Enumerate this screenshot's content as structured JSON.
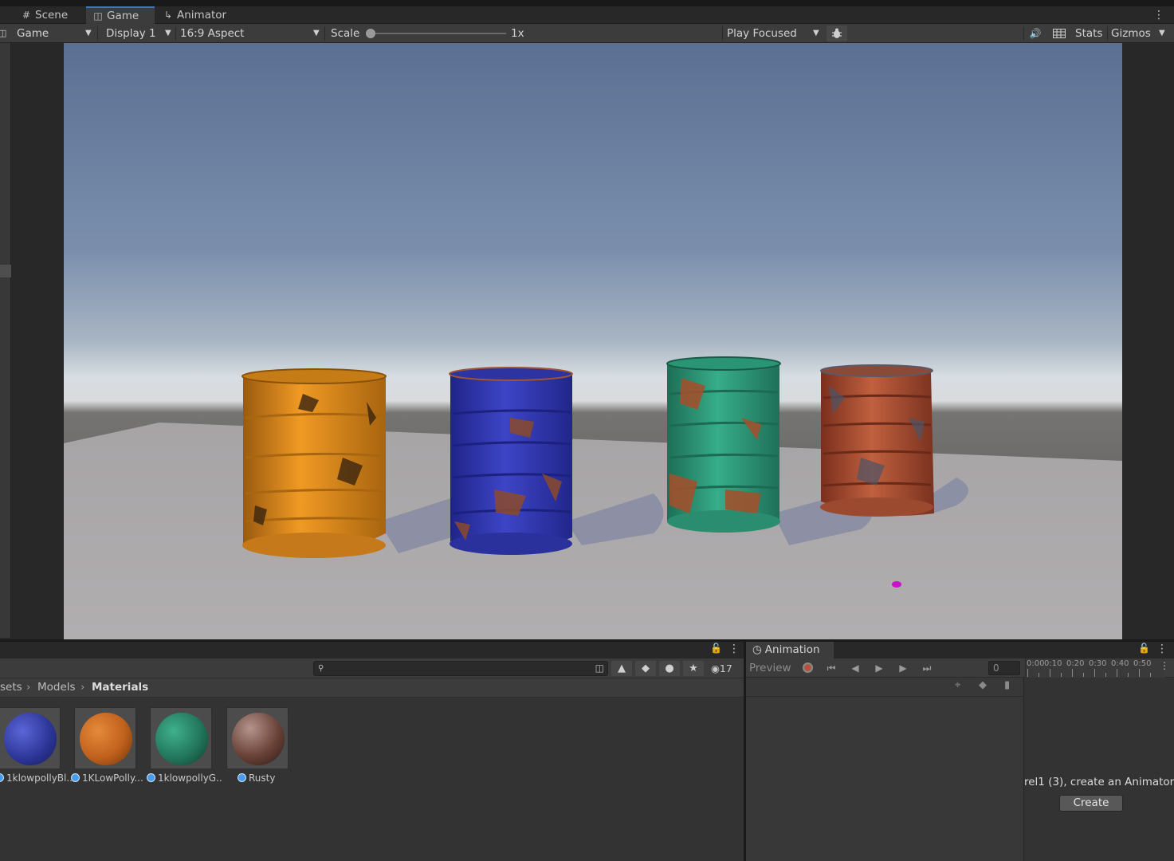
{
  "tabs": [
    {
      "label": "Scene",
      "icon": "grid-icon"
    },
    {
      "label": "Game",
      "icon": "gamepad-icon",
      "active": true
    },
    {
      "label": "Animator",
      "icon": "animator-icon"
    }
  ],
  "toolbar": {
    "view_select": "Game",
    "display_select": "Display 1",
    "aspect_select": "16:9 Aspect",
    "scale_label": "Scale",
    "scale_value": "1x",
    "play_mode_select": "Play Focused",
    "stats_label": "Stats",
    "gizmos_label": "Gizmos"
  },
  "project": {
    "hidden_count": "17",
    "breadcrumb": [
      "sets",
      "Models",
      "Materials"
    ],
    "assets": [
      {
        "label": "1klowpollyBl...",
        "color": "#3b47a6"
      },
      {
        "label": "1KLowPolly...",
        "color": "#c8641e"
      },
      {
        "label": "1klowpollyG...",
        "color": "#2f8a6a"
      },
      {
        "label": "Rusty",
        "color": "#7a4a3c"
      }
    ]
  },
  "animation": {
    "tab_label": "Animation",
    "preview_label": "Preview",
    "frame_value": "0",
    "ruler_labels": [
      "0:00",
      "0:10",
      "0:20",
      "0:30",
      "0:40",
      "0:50"
    ],
    "message": "rel1 (3), create an Animator",
    "create_label": "Create"
  },
  "scene": {
    "barrels": [
      {
        "name": "orange",
        "color": "#d98a1e"
      },
      {
        "name": "blue",
        "color": "#3339b0"
      },
      {
        "name": "green",
        "color": "#2fa07e"
      },
      {
        "name": "rust",
        "color": "#b0563a"
      }
    ]
  }
}
